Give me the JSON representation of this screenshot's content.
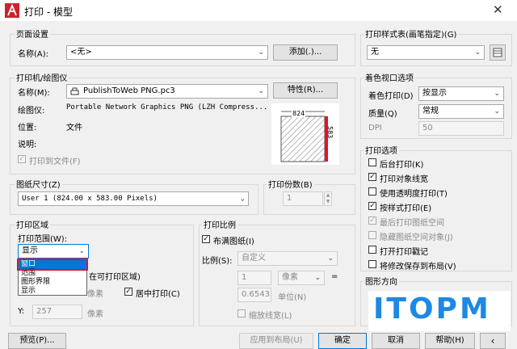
{
  "window": {
    "title": "打印 - 模型",
    "close_glyph": "✕"
  },
  "page_setup": {
    "group_label": "页面设置",
    "name_label": "名称(A):",
    "name_value": "<无>",
    "add_button": "添加(.)..."
  },
  "printer": {
    "group_label": "打印机/绘图仪",
    "name_label": "名称(M):",
    "name_value": "PublishToWeb PNG.pc3",
    "properties_button": "特性(R)...",
    "plotter_label": "绘图仪:",
    "plotter_value": "Portable Network Graphics PNG (LZH Compress...",
    "location_label": "位置:",
    "location_value": "文件",
    "description_label": "说明:",
    "print_to_file_label": "打印到文件(F)",
    "preview_width": "824",
    "preview_height": "583"
  },
  "paper_size": {
    "group_label": "图纸尺寸(Z)",
    "value": "User 1 (824.00 x 583.00 Pixels)"
  },
  "copies": {
    "group_label": "打印份数(B)",
    "value": "1"
  },
  "plot_area": {
    "group_label": "打印区域",
    "range_label": "打印范围(W):",
    "range_value": "显示",
    "options": [
      "窗口",
      "范围",
      "图形界限",
      "显示"
    ],
    "offset_label_partial": "在可打印区域)",
    "x_unit": "像素",
    "center_label": "居中打印(C)",
    "y_label": "Y:",
    "y_value": "257",
    "y_unit": "像素"
  },
  "plot_scale": {
    "group_label": "打印比例",
    "fit_label": "布满图纸(I)",
    "scale_label": "比例(S):",
    "scale_value": "自定义",
    "num_value": "1",
    "unit_value": "像素",
    "equals": "=",
    "den_value": "0.6543",
    "den_unit": "单位(N)",
    "lineweight_label": "缩放线宽(L)"
  },
  "style_table": {
    "group_label": "打印样式表(画笔指定)(G)",
    "value": "无"
  },
  "shaded": {
    "group_label": "着色视口选项",
    "shade_label": "着色打印(D)",
    "shade_value": "按显示",
    "quality_label": "质量(Q)",
    "quality_value": "常规",
    "dpi_label": "DPI",
    "dpi_value": "50"
  },
  "plot_options": {
    "group_label": "打印选项",
    "items": [
      {
        "label": "后台打印(K)",
        "checked": "",
        "disabled": false
      },
      {
        "label": "打印对象线宽",
        "checked": "✓",
        "disabled": false
      },
      {
        "label": "使用透明度打印(T)",
        "checked": "",
        "disabled": false
      },
      {
        "label": "按样式打印(E)",
        "checked": "✓",
        "disabled": false
      },
      {
        "label": "最后打印图纸空间",
        "checked": "✓",
        "disabled": true
      },
      {
        "label": "隐藏图纸空间对象(J)",
        "checked": "",
        "disabled": true
      },
      {
        "label": "打开打印戳记",
        "checked": "",
        "disabled": false
      },
      {
        "label": "将修改保存到布局(V)",
        "checked": "",
        "disabled": false
      }
    ]
  },
  "orientation": {
    "group_label": "图形方向"
  },
  "watermark": "ITOPM",
  "footer": {
    "preview_button": "预览(P)...",
    "apply_button": "应用到布局(U)",
    "ok_button": "确定",
    "cancel_button": "取消",
    "help_button": "帮助(H)"
  }
}
